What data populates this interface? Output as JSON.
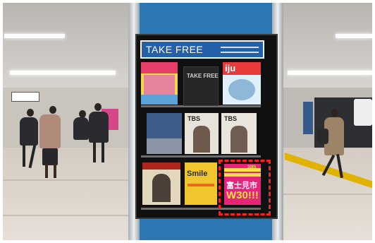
{
  "rack": {
    "header_title": "TAKE FREE"
  },
  "magazines": {
    "top_row": [
      {
        "name": "travel-magazine",
        "label": ""
      },
      {
        "name": "take-free-card",
        "label": "TAKE FREE"
      },
      {
        "name": "iju-magazine",
        "label": "iju"
      }
    ],
    "middle_row": [
      {
        "name": "blue-magazine",
        "label": ""
      },
      {
        "name": "tbs-magazine-1",
        "label": "TBS"
      },
      {
        "name": "tbs-magazine-2",
        "label": "TBS"
      }
    ],
    "bottom_row": [
      {
        "name": "portrait-magazine",
        "label": ""
      },
      {
        "name": "smile-magazine",
        "label": "Smile"
      },
      {
        "name": "fujimi-poster",
        "label": "富士見市",
        "label2": "W30!!!",
        "label3": "30th"
      }
    ]
  },
  "colors": {
    "pillar_blue": "#2c78b5",
    "header_blue": "#2460a8",
    "highlight_red": "#ff2020",
    "poster_pink": "#e5257b"
  }
}
